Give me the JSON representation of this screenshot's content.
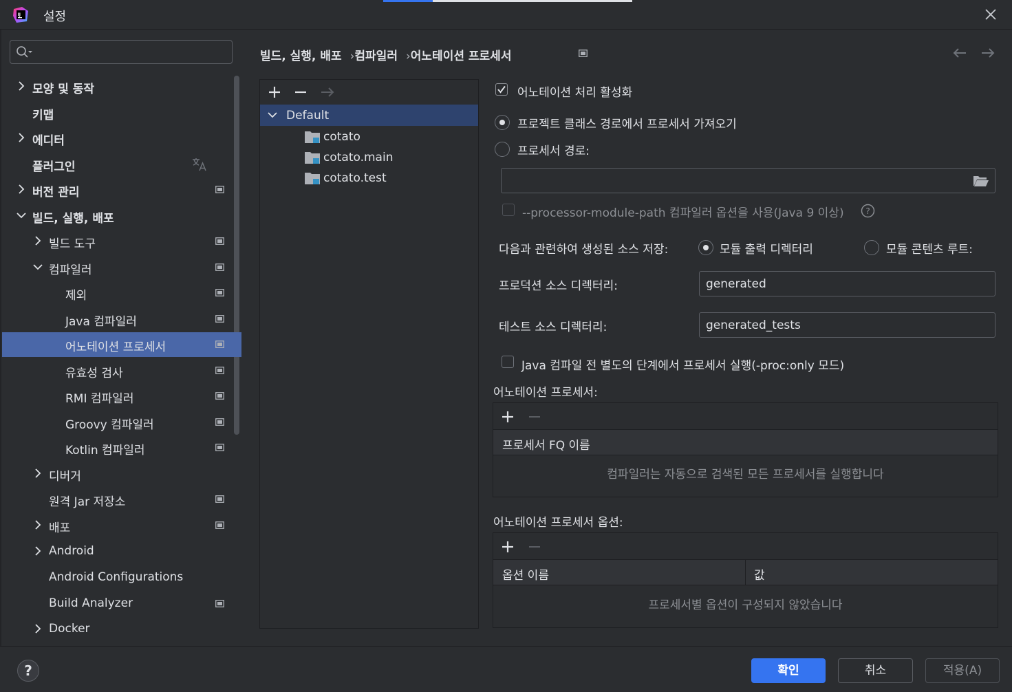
{
  "window": {
    "title": "설정",
    "logo_icon": "intellij-logo-icon",
    "close_icon": "close-icon"
  },
  "search": {
    "placeholder": "",
    "icon": "search-icon"
  },
  "sidebar": {
    "items": [
      {
        "label": "모양 및 동작",
        "chevron": "collapsed"
      },
      {
        "label": "키맵"
      },
      {
        "label": "에디터",
        "chevron": "collapsed"
      },
      {
        "label": "플러그인"
      },
      {
        "label": "버전 관리",
        "chevron": "collapsed"
      },
      {
        "label": "빌드, 실행, 배포",
        "chevron": "expanded"
      },
      {
        "label": "빌드 도구",
        "chevron": "collapsed"
      },
      {
        "label": "컴파일러",
        "chevron": "expanded"
      },
      {
        "label": "제외"
      },
      {
        "label": "Java 컴파일러"
      },
      {
        "label": "어노테이션 프로세서",
        "selected": true
      },
      {
        "label": "유효성 검사"
      },
      {
        "label": "RMI 컴파일러"
      },
      {
        "label": "Groovy 컴파일러"
      },
      {
        "label": "Kotlin 컴파일러"
      },
      {
        "label": "디버거",
        "chevron": "collapsed"
      },
      {
        "label": "원격 Jar 저장소"
      },
      {
        "label": "배포",
        "chevron": "collapsed"
      },
      {
        "label": "Android",
        "chevron": "collapsed"
      },
      {
        "label": "Android Configurations"
      },
      {
        "label": "Build Analyzer"
      },
      {
        "label": "Docker",
        "chevron": "collapsed"
      }
    ]
  },
  "breadcrumb": {
    "items": [
      "빌드, 실행, 배포",
      "컴파일러",
      "어노테이션 프로세서"
    ],
    "separator": "›"
  },
  "profiles": {
    "default_label": "Default",
    "modules": [
      "cotato",
      "cotato.main",
      "cotato.test"
    ]
  },
  "settings": {
    "enable_processing": {
      "label": "어노테이션 처리 활성화",
      "checked": true
    },
    "obtain_from_classpath": {
      "label": "프로젝트 클래스 경로에서 프로세서 가져오기",
      "selected": true
    },
    "processor_path": {
      "label": "프로세서 경로:",
      "selected": false,
      "value": ""
    },
    "module_path_option": {
      "label": "--processor-module-path 컴파일러 옵션을 사용(Java 9 이상)",
      "checked": false
    },
    "store_sources": {
      "label": "다음과 관련하여 생성된 소스 저장:",
      "option_output": "모듈 출력 디렉터리",
      "option_content_root": "모듈 콘텐츠 루트:",
      "selected": "output"
    },
    "production_dir": {
      "label": "프로덕션 소스 디렉터리:",
      "value": "generated"
    },
    "test_dir": {
      "label": "테스트 소스 디렉터리:",
      "value": "generated_tests"
    },
    "proc_only": {
      "label": "Java 컴파일 전 별도의 단계에서 프로세서 실행(-proc:only 모드)",
      "checked": false
    },
    "processors_section": {
      "title": "어노테이션 프로세서:",
      "column": "프로세서 FQ 이름",
      "empty_text": "컴파일러는 자동으로 검색된 모든 프로세서를 실행합니다"
    },
    "options_section": {
      "title": "어노테이션 프로세서 옵션:",
      "col_name": "옵션 이름",
      "col_value": "값",
      "empty_text": "프로세서별 옵션이 구성되지 않았습니다"
    }
  },
  "footer": {
    "help": "?",
    "ok": "확인",
    "cancel": "취소",
    "apply": "적용(A)"
  },
  "colors": {
    "background": "#2b2d30",
    "selection": "#4a67a8",
    "profile_selection": "#2e436e",
    "accent": "#3574f0",
    "text": "#dfe1e5",
    "muted": "#8c8f94"
  }
}
